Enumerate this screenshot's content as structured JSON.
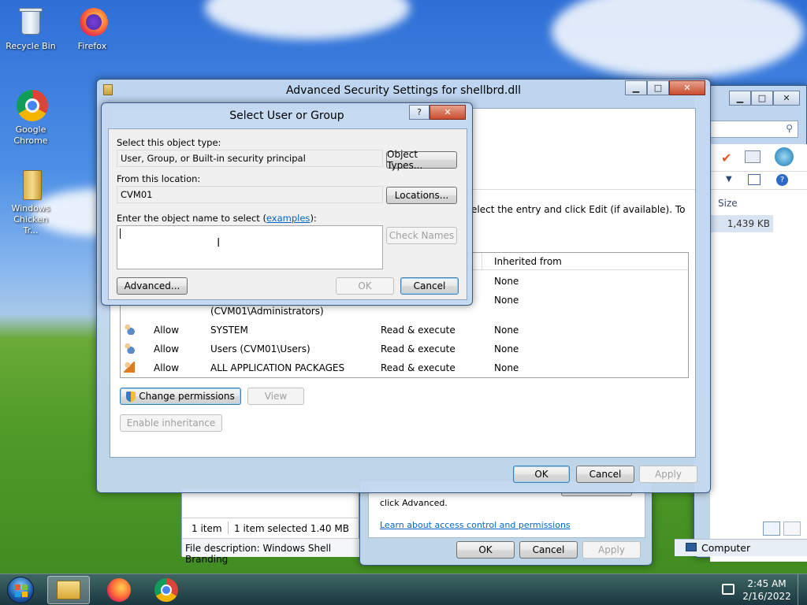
{
  "desktop": {
    "icons": [
      {
        "label": "Recycle Bin"
      },
      {
        "label": "Firefox"
      },
      {
        "label": "Google Chrome"
      },
      {
        "label": "Windows Chicken Tr..."
      }
    ]
  },
  "explorer": {
    "size_header": "Size",
    "size_value": "1,439 KB",
    "status_items": "1 item",
    "status_selected": "1 item selected  1.40 MB",
    "file_description": "File description: Windows Shell Branding",
    "computer_label": "Computer"
  },
  "properties": {
    "advanced_text": "click Advanced.",
    "learn_link": "Learn about access control and permissions",
    "ok": "OK",
    "cancel": "Cancel",
    "apply": "Apply"
  },
  "advanced_security": {
    "title": "Advanced Security Settings for shellbrd.dll",
    "instruction": "elect the entry and click Edit (if available). To",
    "col_inherited": "Inherited from",
    "entries": [
      {
        "type": "",
        "principal": "",
        "access": "",
        "inherited": "None"
      },
      {
        "type": "",
        "principal": "(CVM01\\Administrators)",
        "access": "",
        "inherited": "None"
      },
      {
        "type": "Allow",
        "principal": "SYSTEM",
        "access": "Read & execute",
        "inherited": "None"
      },
      {
        "type": "Allow",
        "principal": "Users (CVM01\\Users)",
        "access": "Read & execute",
        "inherited": "None"
      },
      {
        "type": "Allow",
        "principal": "ALL APPLICATION PACKAGES",
        "access": "Read & execute",
        "inherited": "None"
      }
    ],
    "change_permissions": "Change permissions",
    "view": "View",
    "enable_inheritance": "Enable inheritance",
    "ok": "OK",
    "cancel": "Cancel",
    "apply": "Apply"
  },
  "select_dialog": {
    "title": "Select User or Group",
    "help": "?",
    "object_type_label": "Select this object type:",
    "object_type_value": "User, Group, or Built-in security principal",
    "object_types_button": "Object Types...",
    "location_label": "From this location:",
    "location_value": "CVM01",
    "locations_button": "Locations...",
    "enter_label": "Enter the object name to select (",
    "examples_link": "examples",
    "enter_label_end": "):",
    "object_name_value": "",
    "check_names_button": "Check Names",
    "advanced_button": "Advanced...",
    "ok": "OK",
    "cancel": "Cancel"
  },
  "taskbar": {
    "time": "2:45 AM",
    "date": "2/16/2022"
  }
}
